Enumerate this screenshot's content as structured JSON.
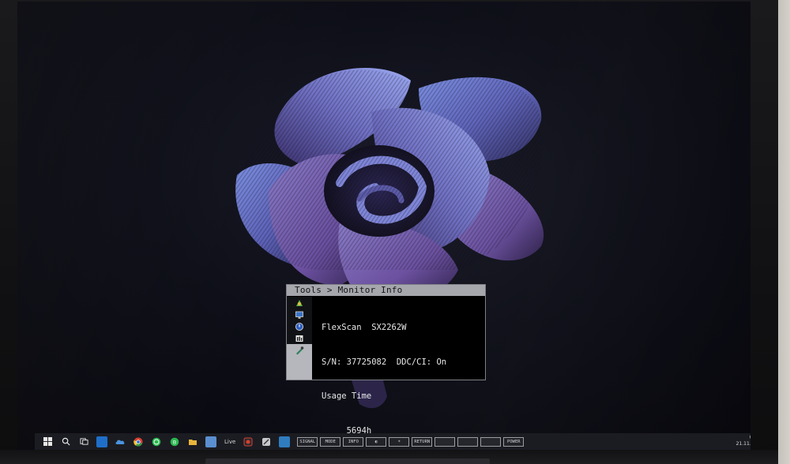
{
  "osd": {
    "breadcrumb": "Tools > Monitor Info",
    "model_name": "FlexScan",
    "model_number": "SX2262W",
    "serial_label": "S/N:",
    "serial_value": "37725082",
    "ddc_label": "DDC/CI:",
    "ddc_value": "On",
    "usage_label": "Usage Time",
    "usage_value": "5694h",
    "sidebar_icons": [
      "color-icon",
      "screen-icon",
      "power-save-icon",
      "tools-icon",
      "monitor-info-icon"
    ]
  },
  "taskbar": {
    "live_label": "Live",
    "buttons": [
      "SIGNAL",
      "MODE",
      "INFO",
      "◐",
      "☀",
      "RETURN",
      "",
      "",
      "",
      "POWER"
    ],
    "time": "07:06",
    "date": "21.11.2025"
  },
  "colors": {
    "osd_header_bg": "#a5a7ad",
    "osd_bg": "#000000",
    "taskbar_bg": "#1b1c22"
  }
}
